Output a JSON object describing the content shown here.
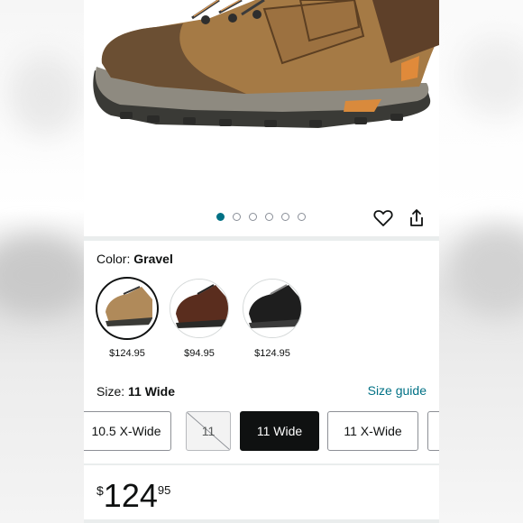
{
  "product": {
    "image_dots_count": 6,
    "active_dot": 0
  },
  "icons": {
    "wishlist": "heart-icon",
    "share": "share-icon"
  },
  "color": {
    "label": "Color:",
    "selected": "Gravel",
    "options": [
      {
        "name": "Gravel",
        "price": "$124.95",
        "selected": true
      },
      {
        "name": "Brown",
        "price": "$94.95",
        "selected": false
      },
      {
        "name": "Black",
        "price": "$124.95",
        "selected": false
      }
    ]
  },
  "size": {
    "label": "Size:",
    "selected": "11 Wide",
    "guide_link": "Size guide",
    "options": [
      {
        "label": "10.5 X-Wide",
        "state": "available"
      },
      {
        "label": "11",
        "state": "unavailable"
      },
      {
        "label": "11 Wide",
        "state": "selected"
      },
      {
        "label": "11 X-Wide",
        "state": "available"
      }
    ]
  },
  "price": {
    "currency": "$",
    "whole": "124",
    "fraction": "95"
  },
  "colors": {
    "accent": "#007185",
    "text": "#0f1111",
    "selected_bg": "#0f1111"
  }
}
